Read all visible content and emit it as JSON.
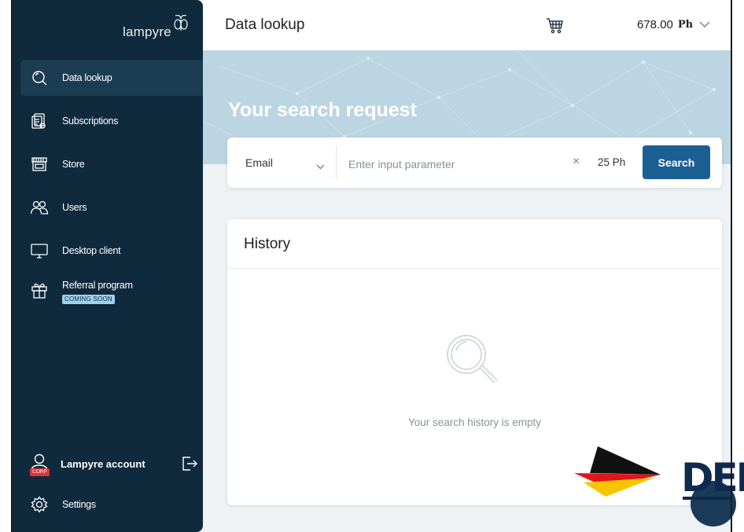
{
  "app": {
    "logo_text": "lampyre"
  },
  "sidebar": {
    "items": [
      {
        "label": "Data lookup",
        "icon": "search-icon",
        "active": true
      },
      {
        "label": "Subscriptions",
        "icon": "subscriptions-icon"
      },
      {
        "label": "Store",
        "icon": "store-icon"
      },
      {
        "label": "Users",
        "icon": "users-icon"
      },
      {
        "label": "Desktop client",
        "icon": "monitor-icon"
      },
      {
        "label": "Referral program",
        "icon": "gift-icon",
        "badge": "COMING SOON"
      }
    ],
    "account": {
      "label": "Lampyre account",
      "badge": "CORP"
    },
    "settings_label": "Settings"
  },
  "header": {
    "title": "Data lookup",
    "balance": "678.00",
    "balance_unit": "Ph"
  },
  "banner": {
    "title": "Your search request"
  },
  "search": {
    "type": "Email",
    "placeholder": "Enter input parameter",
    "clear": "×",
    "cost": "25 Ph",
    "button_label": "Search"
  },
  "history": {
    "title": "History",
    "empty_text": "Your search history is empty"
  },
  "watermark": {
    "text": "DEN"
  },
  "colors": {
    "sidebar_bg": "#0f2a3d",
    "active_item": "#1c3c52",
    "primary": "#1c5f93",
    "banner": "#bcd5e2",
    "content_bg": "#eef2f5"
  }
}
